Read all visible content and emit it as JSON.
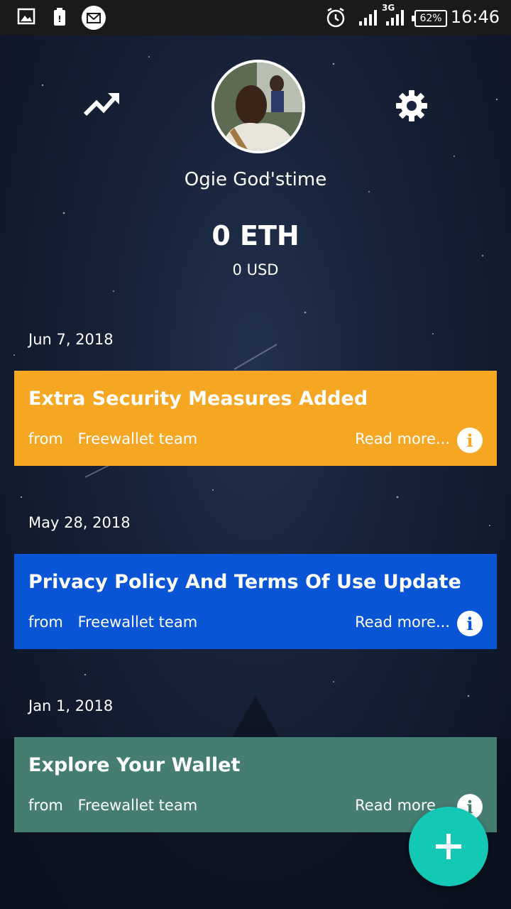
{
  "status_bar": {
    "battery": "62%",
    "network": "3G",
    "time": "16:46",
    "icons": [
      "image-icon",
      "storage-warning-icon",
      "mail-icon",
      "alarm-icon",
      "signal-icon",
      "signal-3g-icon",
      "battery-icon"
    ]
  },
  "header": {
    "left_icon": "trending-up-icon",
    "right_icon": "gear-icon",
    "username": "Ogie God'stime"
  },
  "balance": {
    "eth": "0 ETH",
    "usd": "0 USD"
  },
  "news": [
    {
      "date": "Jun 7, 2018",
      "title": "Extra Security Measures Added",
      "from_label": "from",
      "author": "Freewallet team",
      "read_more": "Read more...",
      "color": "#f5a623"
    },
    {
      "date": "May 28, 2018",
      "title": "Privacy Policy And Terms Of Use Update",
      "from_label": "from",
      "author": "Freewallet team",
      "read_more": "Read more...",
      "color": "#0a55d6"
    },
    {
      "date": "Jan 1, 2018",
      "title": "Explore Your Wallet",
      "from_label": "from",
      "author": "Freewallet team",
      "read_more": "Read more...",
      "color": "#457d72"
    }
  ],
  "fab": {
    "icon": "plus-icon",
    "color": "#13c8b5"
  }
}
